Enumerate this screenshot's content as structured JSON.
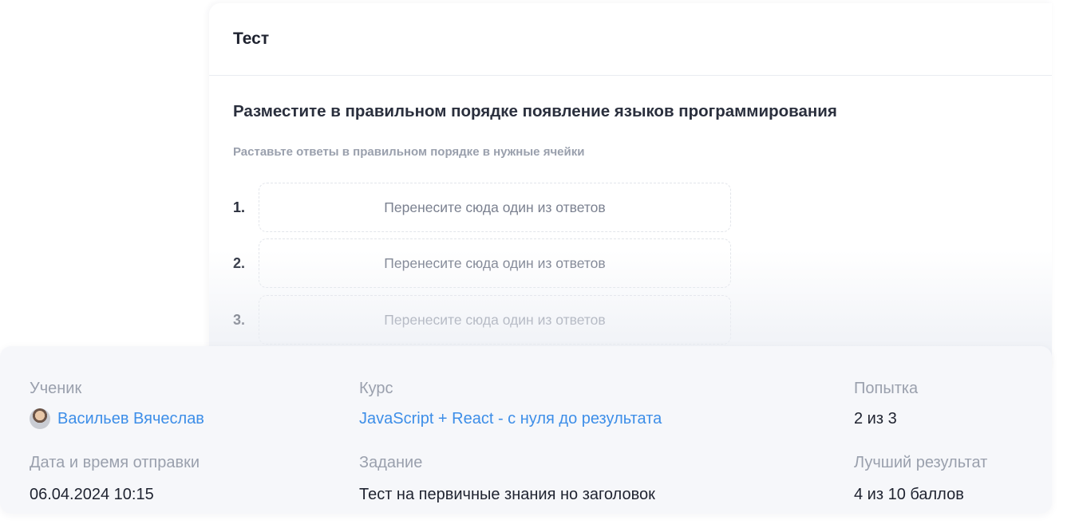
{
  "card": {
    "title": "Тест",
    "question": "Разместите в правильном порядке появление языков программирования",
    "hint": "Раставьте ответы в правильном порядке в нужные ячейки",
    "slots": [
      {
        "number": "1.",
        "placeholder": "Перенесите сюда один из ответов"
      },
      {
        "number": "2.",
        "placeholder": "Перенесите сюда один из ответов"
      },
      {
        "number": "3.",
        "placeholder": "Перенесите сюда один из ответов"
      }
    ]
  },
  "info": {
    "student_label": "Ученик",
    "student_name": "Васильев Вячеслав",
    "course_label": "Курс",
    "course_name": "JavaScript + React - с нуля до результата",
    "attempt_label": "Попытка",
    "attempt_value": "2 из 3",
    "sent_label": "Дата и время отправки",
    "sent_value": "06.04.2024 10:15",
    "task_label": "Задание",
    "task_value": "Тест на первичные знания но заголовок",
    "best_label": "Лучший результат",
    "best_value": "4 из 10 баллов"
  },
  "colors": {
    "link": "#3d8ee8",
    "muted": "#9aa0ad",
    "text": "#1f2330",
    "panel_bg": "#f6f7fa"
  }
}
